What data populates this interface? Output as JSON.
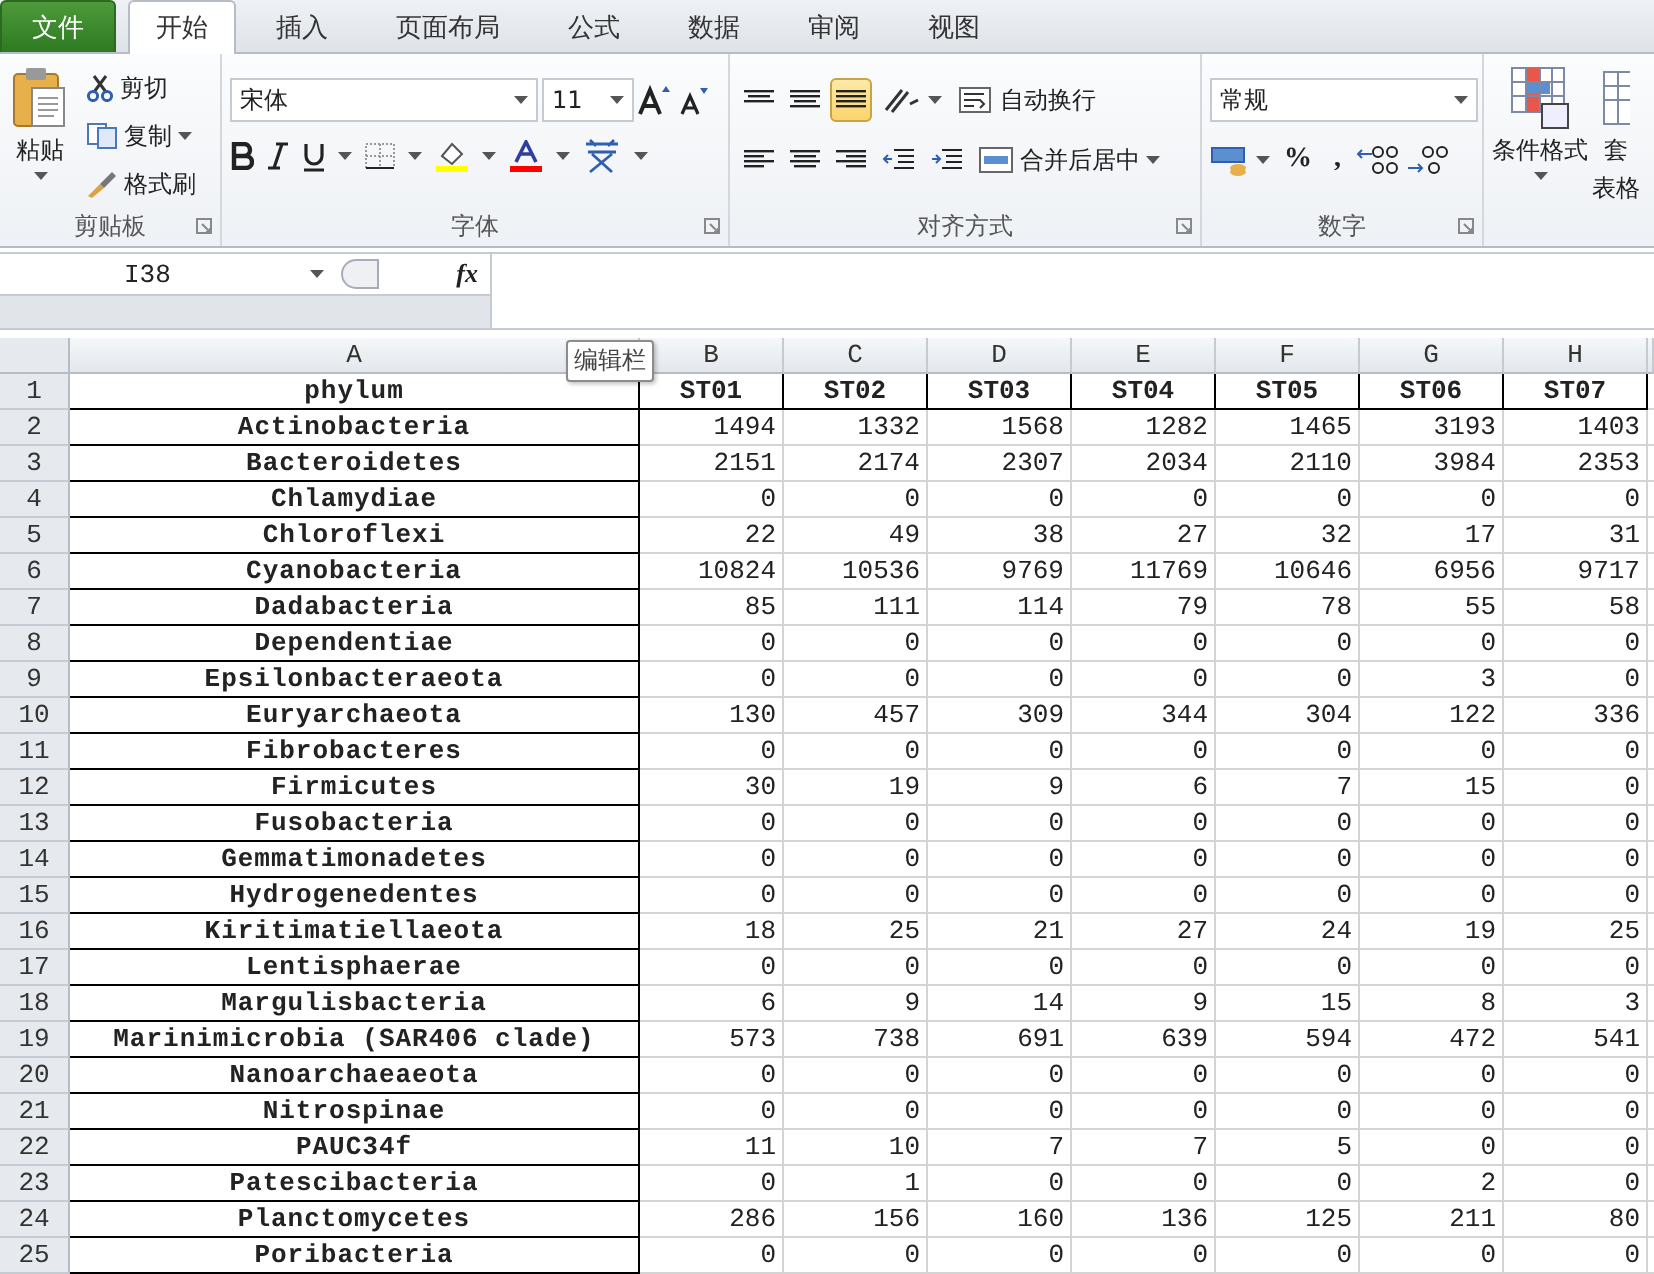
{
  "tabs": [
    {
      "label": "文件",
      "kind": "file",
      "selected": false
    },
    {
      "label": "开始",
      "kind": "tab",
      "selected": true
    },
    {
      "label": "插入",
      "kind": "tab",
      "selected": false
    },
    {
      "label": "页面布局",
      "kind": "tab",
      "selected": false
    },
    {
      "label": "公式",
      "kind": "tab",
      "selected": false
    },
    {
      "label": "数据",
      "kind": "tab",
      "selected": false
    },
    {
      "label": "审阅",
      "kind": "tab",
      "selected": false
    },
    {
      "label": "视图",
      "kind": "tab",
      "selected": false
    }
  ],
  "ribbon": {
    "clipboard": {
      "label": "剪贴板",
      "paste": "粘贴",
      "cut": "剪切",
      "copy": "复制",
      "format_painter": "格式刷"
    },
    "font": {
      "label": "字体",
      "font_name": "宋体",
      "font_size": "11"
    },
    "alignment": {
      "label": "对齐方式",
      "wrap_text": "自动换行",
      "merge_center": "合并后居中",
      "vertical_align": [
        {
          "selected": false
        },
        {
          "selected": false
        },
        {
          "selected": true
        }
      ]
    },
    "number": {
      "label": "数字",
      "format": "常规",
      "percent": "%",
      "comma": ","
    },
    "styles": {
      "conditional_format": "条件格式",
      "table_format_top": "套",
      "table_format_bottom": "表格"
    }
  },
  "formula_bar": {
    "name_box": "I38",
    "function_label": "fx",
    "tooltip": "编辑栏"
  },
  "sheet": {
    "columns": [
      "A",
      "B",
      "C",
      "D",
      "E",
      "F",
      "G",
      "H"
    ],
    "rows": [
      {
        "number": "1",
        "kind": "header",
        "cells": [
          "phylum",
          "ST01",
          "ST02",
          "ST03",
          "ST04",
          "ST05",
          "ST06",
          "ST07"
        ]
      },
      {
        "number": "2",
        "kind": "data",
        "cells": [
          "Actinobacteria",
          "1494",
          "1332",
          "1568",
          "1282",
          "1465",
          "3193",
          "1403"
        ]
      },
      {
        "number": "3",
        "kind": "data",
        "cells": [
          "Bacteroidetes",
          "2151",
          "2174",
          "2307",
          "2034",
          "2110",
          "3984",
          "2353"
        ]
      },
      {
        "number": "4",
        "kind": "data",
        "cells": [
          "Chlamydiae",
          "0",
          "0",
          "0",
          "0",
          "0",
          "0",
          "0"
        ]
      },
      {
        "number": "5",
        "kind": "data",
        "cells": [
          "Chloroflexi",
          "22",
          "49",
          "38",
          "27",
          "32",
          "17",
          "31"
        ]
      },
      {
        "number": "6",
        "kind": "data",
        "cells": [
          "Cyanobacteria",
          "10824",
          "10536",
          "9769",
          "11769",
          "10646",
          "6956",
          "9717"
        ]
      },
      {
        "number": "7",
        "kind": "data",
        "cells": [
          "Dadabacteria",
          "85",
          "111",
          "114",
          "79",
          "78",
          "55",
          "58"
        ]
      },
      {
        "number": "8",
        "kind": "data",
        "cells": [
          "Dependentiae",
          "0",
          "0",
          "0",
          "0",
          "0",
          "0",
          "0"
        ]
      },
      {
        "number": "9",
        "kind": "data",
        "cells": [
          "Epsilonbacteraeota",
          "0",
          "0",
          "0",
          "0",
          "0",
          "3",
          "0"
        ]
      },
      {
        "number": "10",
        "kind": "data",
        "cells": [
          "Euryarchaeota",
          "130",
          "457",
          "309",
          "344",
          "304",
          "122",
          "336"
        ]
      },
      {
        "number": "11",
        "kind": "data",
        "cells": [
          "Fibrobacteres",
          "0",
          "0",
          "0",
          "0",
          "0",
          "0",
          "0"
        ]
      },
      {
        "number": "12",
        "kind": "data",
        "cells": [
          "Firmicutes",
          "30",
          "19",
          "9",
          "6",
          "7",
          "15",
          "0"
        ]
      },
      {
        "number": "13",
        "kind": "data",
        "cells": [
          "Fusobacteria",
          "0",
          "0",
          "0",
          "0",
          "0",
          "0",
          "0"
        ]
      },
      {
        "number": "14",
        "kind": "data",
        "cells": [
          "Gemmatimonadetes",
          "0",
          "0",
          "0",
          "0",
          "0",
          "0",
          "0"
        ]
      },
      {
        "number": "15",
        "kind": "data",
        "cells": [
          "Hydrogenedentes",
          "0",
          "0",
          "0",
          "0",
          "0",
          "0",
          "0"
        ]
      },
      {
        "number": "16",
        "kind": "data",
        "cells": [
          "Kiritimatiellaeota",
          "18",
          "25",
          "21",
          "27",
          "24",
          "19",
          "25"
        ]
      },
      {
        "number": "17",
        "kind": "data",
        "cells": [
          "Lentisphaerae",
          "0",
          "0",
          "0",
          "0",
          "0",
          "0",
          "0"
        ]
      },
      {
        "number": "18",
        "kind": "data",
        "cells": [
          "Margulisbacteria",
          "6",
          "9",
          "14",
          "9",
          "15",
          "8",
          "3"
        ]
      },
      {
        "number": "19",
        "kind": "data",
        "cells": [
          "Marinimicrobia (SAR406 clade)",
          "573",
          "738",
          "691",
          "639",
          "594",
          "472",
          "541"
        ]
      },
      {
        "number": "20",
        "kind": "data",
        "cells": [
          "Nanoarchaeaeota",
          "0",
          "0",
          "0",
          "0",
          "0",
          "0",
          "0"
        ]
      },
      {
        "number": "21",
        "kind": "data",
        "cells": [
          "Nitrospinae",
          "0",
          "0",
          "0",
          "0",
          "0",
          "0",
          "0"
        ]
      },
      {
        "number": "22",
        "kind": "data",
        "cells": [
          "PAUC34f",
          "11",
          "10",
          "7",
          "7",
          "5",
          "0",
          "0"
        ]
      },
      {
        "number": "23",
        "kind": "data",
        "cells": [
          "Patescibacteria",
          "0",
          "1",
          "0",
          "0",
          "0",
          "2",
          "0"
        ]
      },
      {
        "number": "24",
        "kind": "data",
        "cells": [
          "Planctomycetes",
          "286",
          "156",
          "160",
          "136",
          "125",
          "211",
          "80"
        ]
      },
      {
        "number": "25",
        "kind": "data",
        "cells": [
          "Poribacteria",
          "0",
          "0",
          "0",
          "0",
          "0",
          "0",
          "0"
        ]
      }
    ]
  }
}
